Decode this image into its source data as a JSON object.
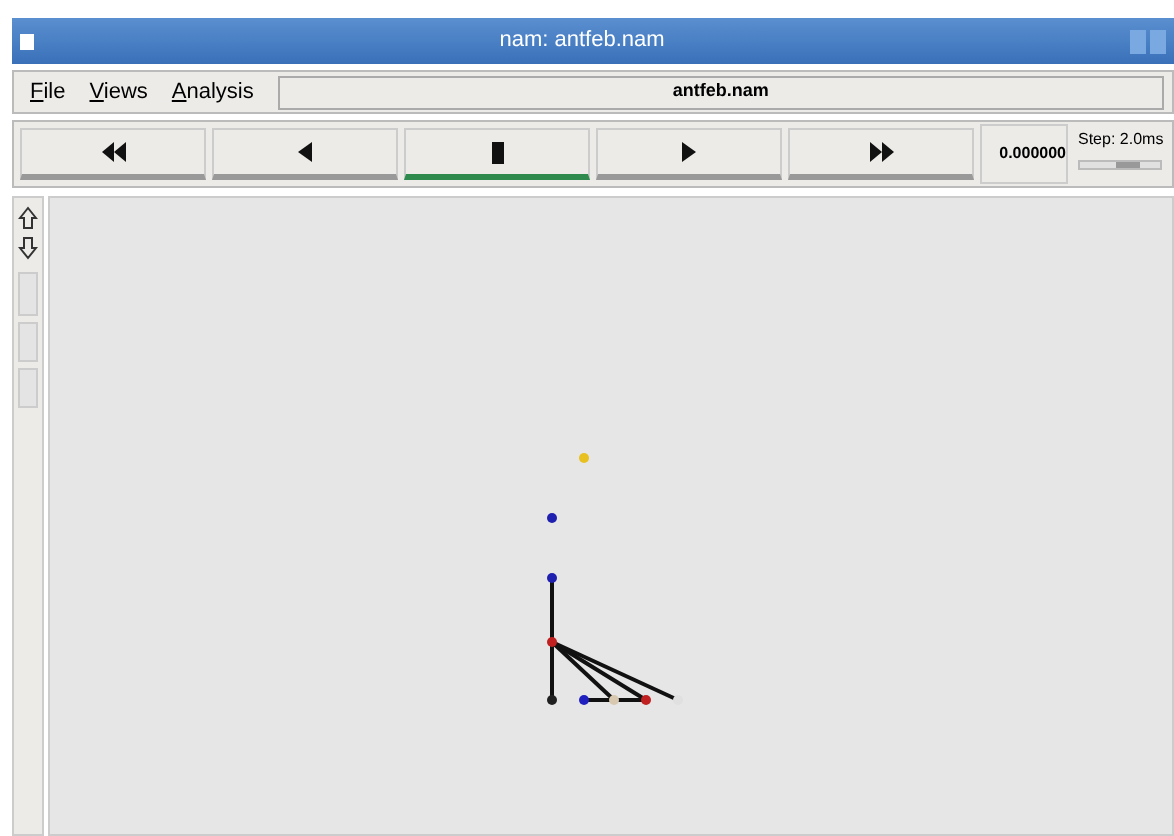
{
  "window": {
    "title": "nam: antfeb.nam"
  },
  "menus": [
    {
      "mnemonic": "F",
      "rest": "ile"
    },
    {
      "mnemonic": "V",
      "rest": "iews"
    },
    {
      "mnemonic": "A",
      "rest": "nalysis"
    }
  ],
  "file_field": {
    "value": "antfeb.nam"
  },
  "playback": [
    {
      "kind": "rewind",
      "selected": false
    },
    {
      "kind": "back",
      "selected": false
    },
    {
      "kind": "stop",
      "selected": true
    },
    {
      "kind": "play",
      "selected": false
    },
    {
      "kind": "forward",
      "selected": false
    }
  ],
  "time": "0.000000",
  "step": {
    "label": "Step: 2.0ms",
    "level": 0.6
  },
  "network": {
    "nodes": [
      {
        "color": "#e8c020"
      },
      {
        "color": "#2020b0"
      },
      {
        "color": "#2020b0"
      },
      {
        "color": "#c02020"
      },
      {
        "color": "#202020"
      },
      {
        "color": "#2020c0"
      },
      {
        "color": "#d8c8b0"
      },
      {
        "color": "#c02020"
      },
      {
        "color": "#e0e0e0"
      }
    ]
  }
}
